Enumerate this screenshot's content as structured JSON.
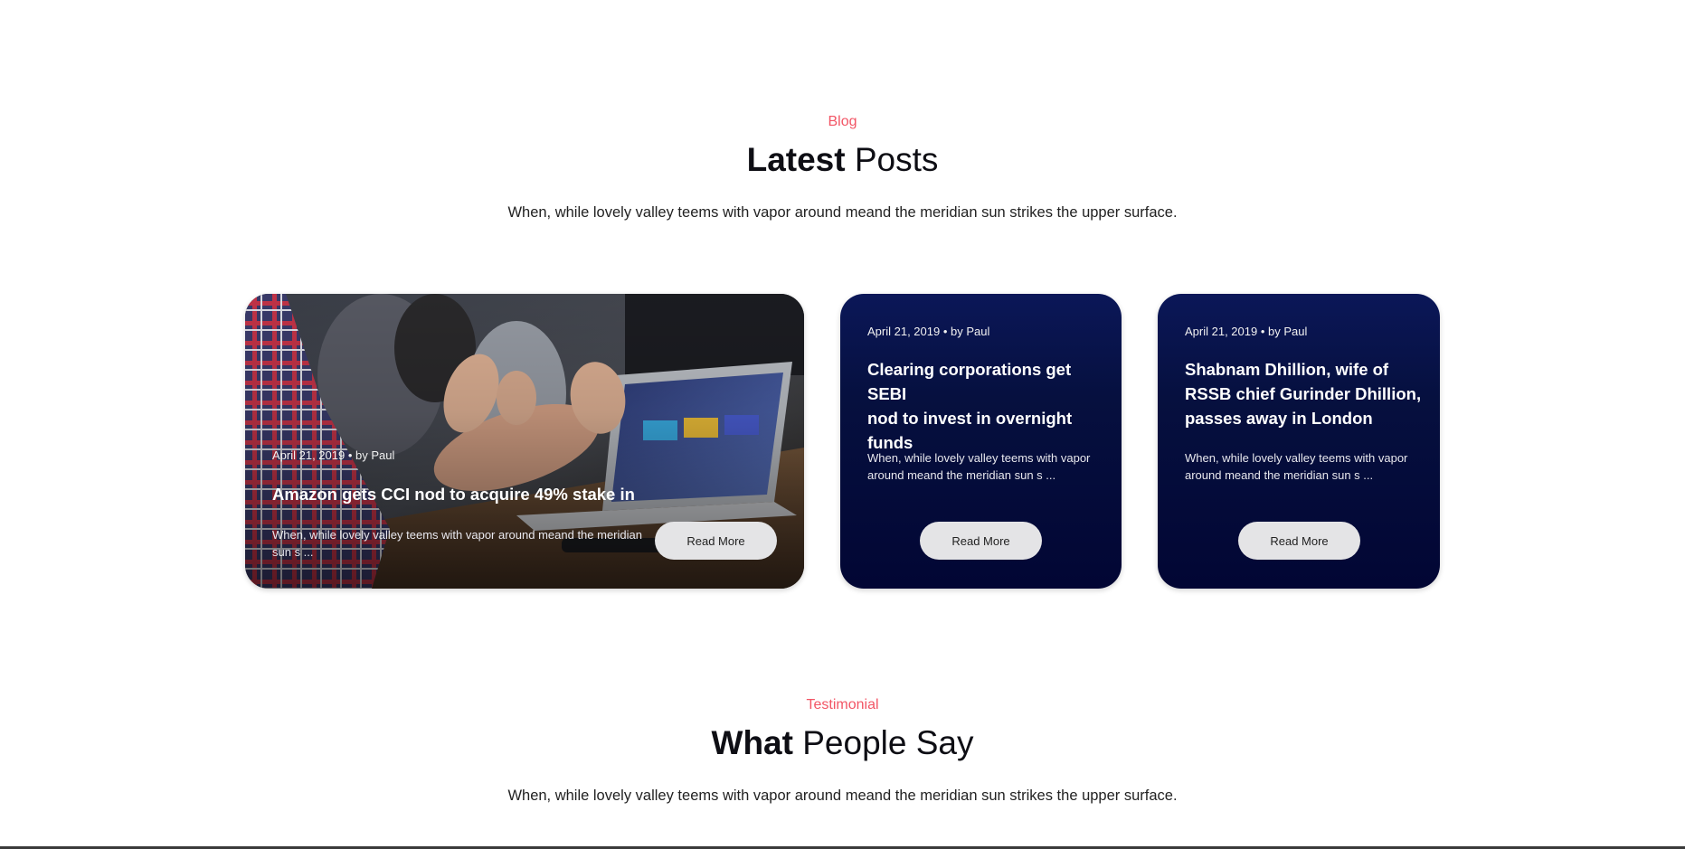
{
  "blog": {
    "eyebrow": "Blog",
    "heading_bold": "Latest",
    "heading_rest": "Posts",
    "lead": "When, while lovely valley teems with vapor around meand the meridian sun strikes the upper surface."
  },
  "posts": [
    {
      "meta": "April 21, 2019 • by Paul",
      "title": "Amazon gets CCI nod to acquire 49% stake in",
      "excerpt_line1": "When, while lovely valley teems with vapor around meand the meridian",
      "excerpt_line2": "sun s ...",
      "button": "Read More"
    },
    {
      "meta": "April 21, 2019 • by Paul",
      "title_line1": "Clearing corporations get SEBI",
      "title_line2": "nod to invest in overnight",
      "title_line3": "funds",
      "excerpt_line1": "When, while lovely valley teems with vapor",
      "excerpt_line2": "around meand the meridian sun s ...",
      "button": "Read More"
    },
    {
      "meta": "April 21, 2019 • by Paul",
      "title_line1": "Shabnam Dhillion, wife of",
      "title_line2": "RSSB chief Gurinder Dhillion,",
      "title_line3": "passes away in London",
      "excerpt_line1": "When, while lovely valley teems with vapor",
      "excerpt_line2": "around meand the meridian sun s ...",
      "button": "Read More"
    }
  ],
  "testimonial": {
    "eyebrow": "Testimonial",
    "heading_bold": "What",
    "heading_rest": "People Say",
    "lead": "When, while lovely valley teems with vapor around meand the meridian sun strikes the upper surface."
  },
  "colors": {
    "accent": "#f25565",
    "card_navy": "#020634",
    "button_bg": "#e4e4e6"
  }
}
